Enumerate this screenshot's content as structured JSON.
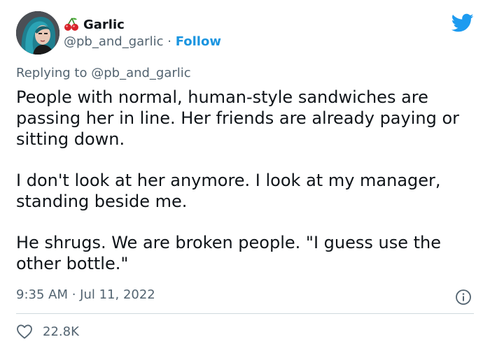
{
  "author": {
    "display_name": "Garlic",
    "name_emoji": "cherries-emoji",
    "handle": "@pb_and_garlic",
    "separator": "·",
    "follow_label": "Follow"
  },
  "reply_context": {
    "prefix": "Replying to",
    "mention": "@pb_and_garlic"
  },
  "tweet": {
    "paragraphs": [
      "People with normal, human-style sandwiches are passing her in line. Her friends are already paying or sitting down.",
      "I don't look at her anymore. I look at my manager, standing beside me.",
      "He shrugs. We are broken people. \"I guess use the other bottle.\""
    ],
    "timestamp": "9:35 AM · Jul 11, 2022"
  },
  "engagement": {
    "likes": "22.8K"
  },
  "icons": {
    "brand": "twitter-bird-icon",
    "info": "info-icon",
    "like": "heart-icon"
  },
  "colors": {
    "brand_blue": "#1d9bf0",
    "link_blue": "#1b95e0",
    "secondary_text": "#536471",
    "primary_text": "#0f1419",
    "divider": "#cfd9de"
  }
}
